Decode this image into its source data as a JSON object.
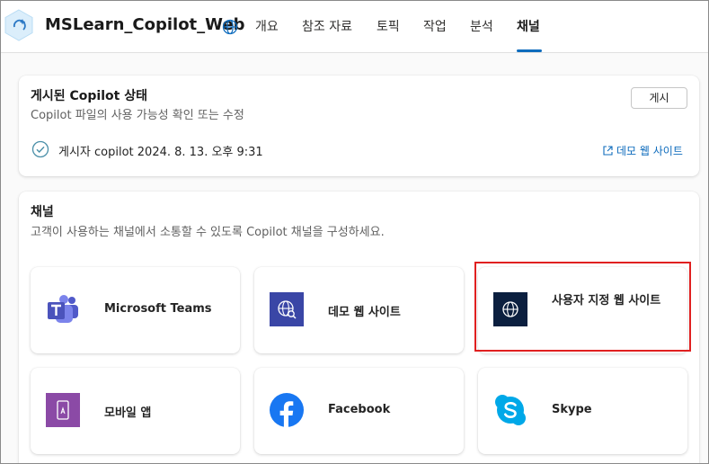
{
  "header": {
    "app_title": "MSLearn_Copilot_Web",
    "tabs": [
      {
        "label": "개요"
      },
      {
        "label": "참조 자료"
      },
      {
        "label": "토픽"
      },
      {
        "label": "작업"
      },
      {
        "label": "분석"
      },
      {
        "label": "채널",
        "active": true
      }
    ]
  },
  "publish_card": {
    "title": "게시된 Copilot 상태",
    "subtitle": "Copilot 파일의 사용 가능성 확인 또는 수정",
    "publish_button": "게시",
    "status_text": "게시자 copilot 2024. 8. 13. 오후 9:31",
    "demo_link": "데모 웹 사이트"
  },
  "channels_card": {
    "title": "채널",
    "subtitle": "고객이 사용하는 채널에서 소통할 수 있도록 Copilot 채널을 구성하세요.",
    "tiles": [
      {
        "label": "Microsoft Teams",
        "icon": "teams-icon"
      },
      {
        "label": "데모 웹 사이트",
        "icon": "demo-website-icon"
      },
      {
        "label": "사용자 지정 웹 사이트",
        "icon": "custom-website-icon"
      },
      {
        "label": "모바일 앱",
        "icon": "mobile-app-icon"
      },
      {
        "label": "Facebook",
        "icon": "facebook-icon"
      },
      {
        "label": "Skype",
        "icon": "skype-icon"
      }
    ]
  },
  "colors": {
    "accent": "#0f6cbd",
    "highlight": "#e02020",
    "teams": "#5059c9",
    "demo_web": "#3a46a6",
    "custom_web": "#0b1f3f",
    "mobile": "#8b4aa6",
    "facebook": "#1877f2",
    "skype": "#00a8e8"
  }
}
